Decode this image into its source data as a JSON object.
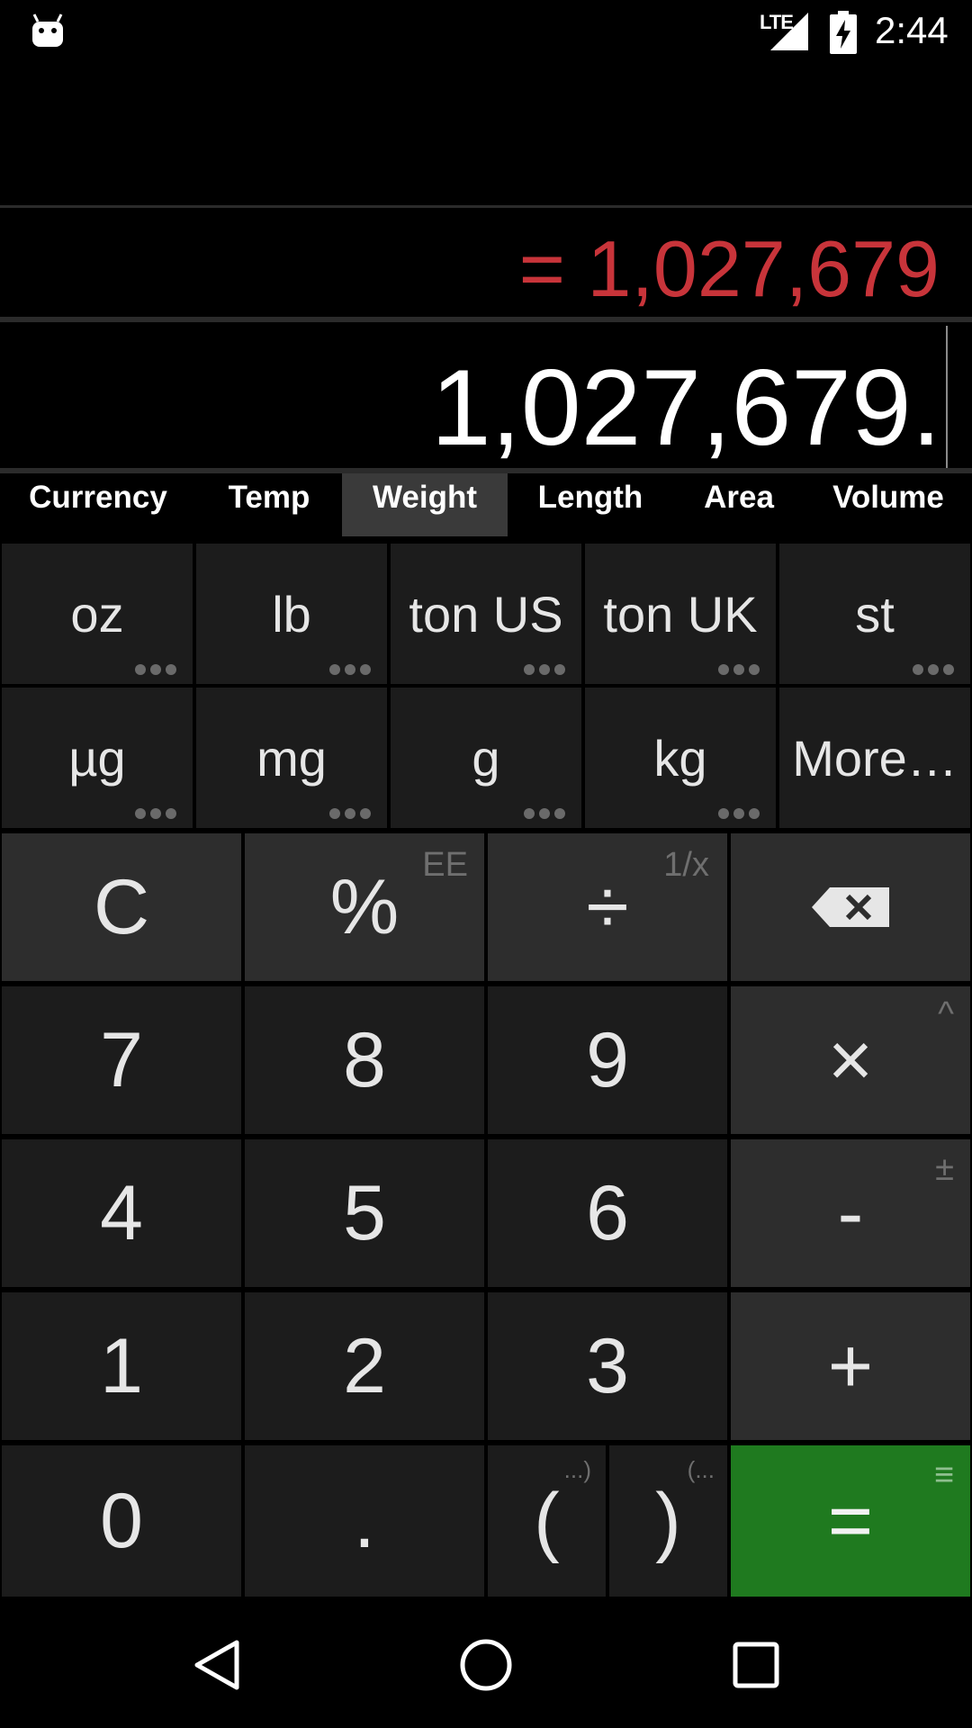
{
  "status_bar": {
    "network": "LTE",
    "time": "2:44"
  },
  "display": {
    "result": "= 1,027,679",
    "expression": "1,027,679."
  },
  "tabs": [
    {
      "label": "Currency",
      "active": false
    },
    {
      "label": "Temp",
      "active": false
    },
    {
      "label": "Weight",
      "active": true
    },
    {
      "label": "Length",
      "active": false
    },
    {
      "label": "Area",
      "active": false
    },
    {
      "label": "Volume",
      "active": false
    }
  ],
  "units_row1": [
    "oz",
    "lb",
    "ton US",
    "ton UK",
    "st"
  ],
  "units_row2": [
    "µg",
    "mg",
    "g",
    "kg",
    "More…"
  ],
  "keypad": {
    "clear": "C",
    "percent": "%",
    "percent_alt": "EE",
    "divide": "÷",
    "divide_alt": "1/x",
    "multiply": "×",
    "multiply_alt": "^",
    "minus": "-",
    "minus_alt": "±",
    "plus": "+",
    "equals": "=",
    "equals_alt": "≡",
    "digits": [
      "7",
      "8",
      "9",
      "4",
      "5",
      "6",
      "1",
      "2",
      "3"
    ],
    "zero": "0",
    "dot": ".",
    "open_paren": "(",
    "open_paren_alt": "...)",
    "close_paren": ")",
    "close_paren_alt": "(...",
    "accent_color": "#1f7a1f",
    "result_color": "#c8343a"
  }
}
